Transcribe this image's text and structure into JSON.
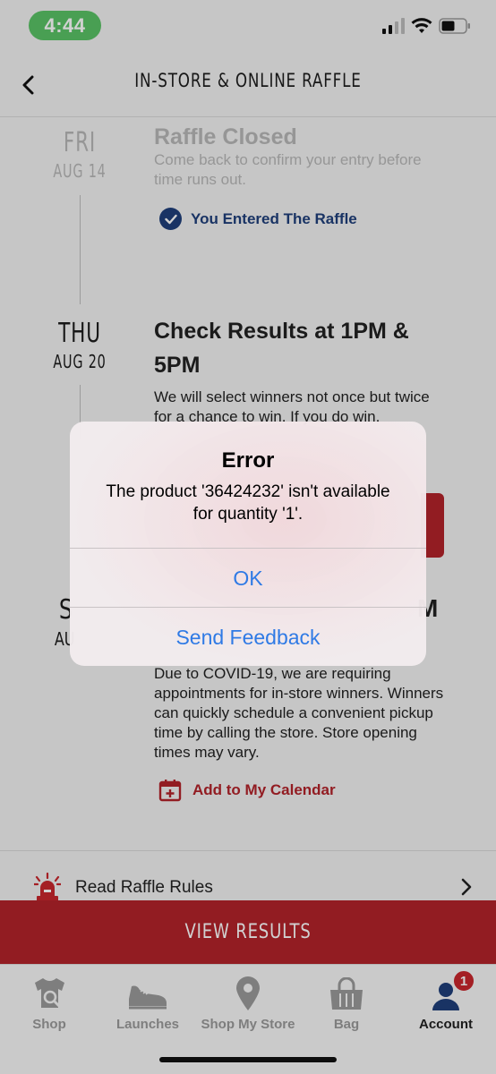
{
  "status_bar": {
    "time": "4:44"
  },
  "header": {
    "title": "IN-STORE & ONLINE RAFFLE"
  },
  "timeline": {
    "step1": {
      "day": "FRI",
      "date": "AUG 14",
      "title": "Raffle Closed",
      "body": "Come back to confirm your entry before time runs out.",
      "status": "You Entered The Raffle"
    },
    "step2": {
      "day": "THU",
      "date": "AUG 20",
      "title": "Check Results at 1PM & 5PM",
      "body": "We will select winners not once but twice for a chance to win. If you do win,"
    },
    "step3": {
      "day_partial": "S",
      "date_partial": "AU",
      "title_partial": "M",
      "body": "Due to COVID-19, we are requiring appointments for in-store winners. Winners can quickly schedule a convenient pickup time by calling the store. Store opening times may vary.",
      "calendar_link": "Add to My Calendar"
    }
  },
  "rules": {
    "label": "Read Raffle Rules"
  },
  "view_results": {
    "label": "VIEW RESULTS"
  },
  "tabbar": {
    "tabs": [
      {
        "label": "Shop"
      },
      {
        "label": "Launches"
      },
      {
        "label": "Shop My Store"
      },
      {
        "label": "Bag"
      },
      {
        "label": "Account"
      }
    ],
    "account_badge": "1"
  },
  "alert": {
    "title": "Error",
    "message": "The product '36424232' isn't available for quantity '1'.",
    "ok_label": "OK",
    "feedback_label": "Send Feedback"
  },
  "colors": {
    "brand_red": "#b3232a",
    "link_blue": "#2f7ae5",
    "entered_blue": "#1f3f7a",
    "status_green": "#5ac366"
  }
}
